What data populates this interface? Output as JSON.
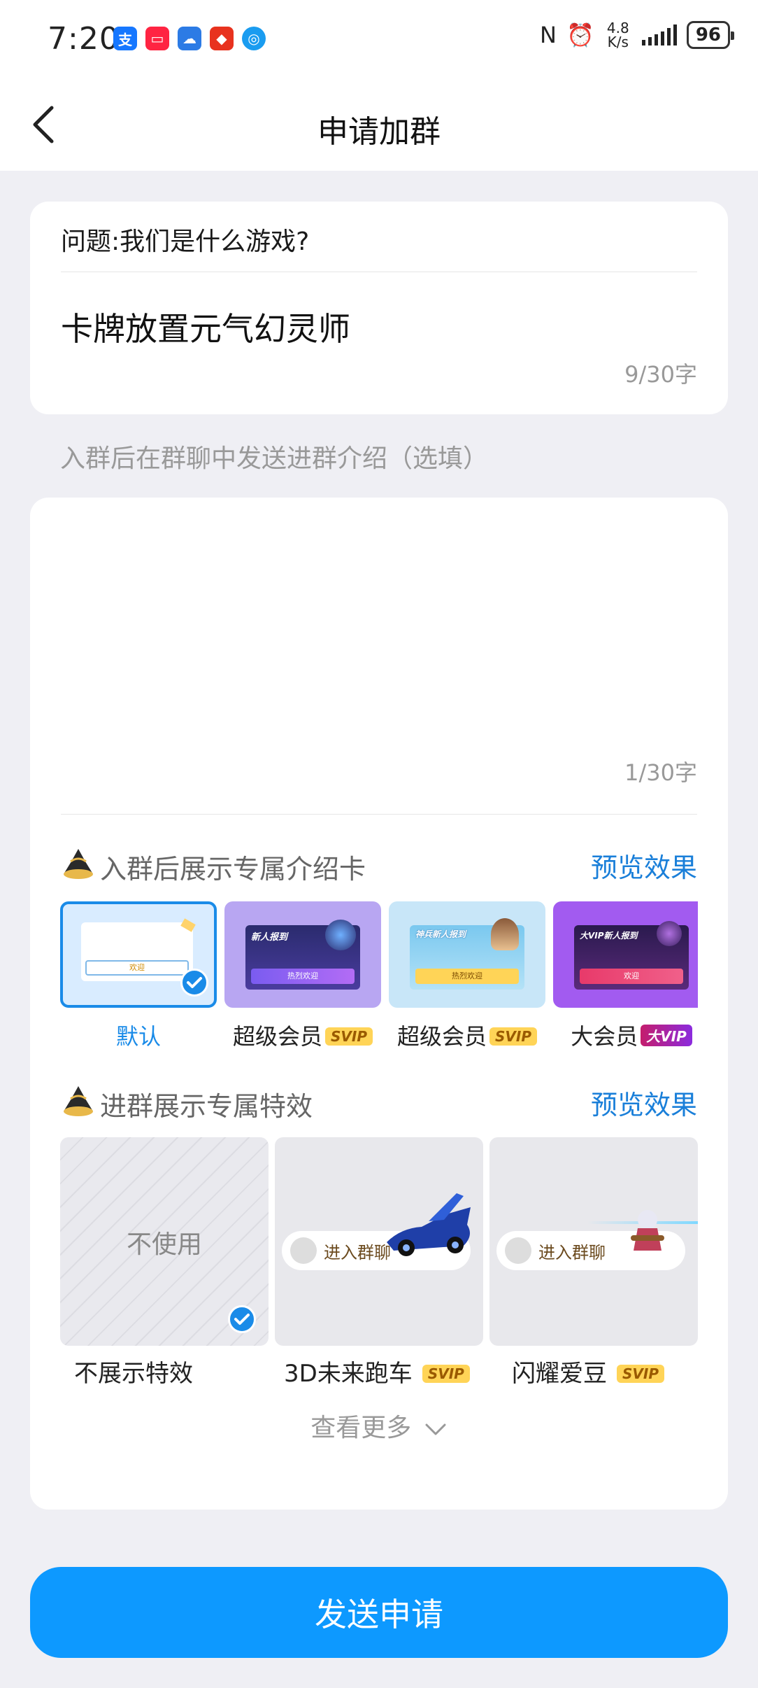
{
  "status_bar": {
    "time": "7:20",
    "net_speed": "4.8 K/s",
    "battery": "96",
    "app_icons": [
      "alipay-icon",
      "red-note-icon",
      "weather-icon",
      "shop-icon",
      "browser-icon"
    ]
  },
  "nav": {
    "title": "申请加群"
  },
  "question": {
    "text": "问题:我们是什么游戏?",
    "answer": "卡牌放置元气幻灵师",
    "count": "9/30字"
  },
  "intro": {
    "label": "入群后在群聊中发送进群介绍（选填）",
    "value": "",
    "count": "1/30字"
  },
  "intro_cards": {
    "title": "入群后展示专属介绍卡",
    "preview": "预览效果",
    "items": [
      {
        "label": "默认",
        "badge": "",
        "selected": true,
        "thumb_text": "欢迎"
      },
      {
        "label": "超级会员",
        "badge": "SVIP",
        "selected": false,
        "thumb_title": "新人报到",
        "thumb_text": "热烈欢迎"
      },
      {
        "label": "超级会员",
        "badge": "SVIP",
        "selected": false,
        "thumb_title": "神兵新人报到",
        "thumb_text": "热烈欢迎"
      },
      {
        "label": "大会员",
        "badge": "大VIP",
        "selected": false,
        "thumb_title": "大VIP新人报到",
        "thumb_text": "欢迎"
      }
    ]
  },
  "effects": {
    "title": "进群展示专属特效",
    "preview": "预览效果",
    "none_text": "不使用",
    "items": [
      {
        "label": "不展示特效",
        "badge": "",
        "selected": true
      },
      {
        "label": "3D未来跑车",
        "badge": "SVIP",
        "selected": false,
        "pill_text": "进入群聊"
      },
      {
        "label": "闪耀爱豆",
        "badge": "SVIP",
        "selected": false,
        "pill_text": "进入群聊"
      }
    ],
    "see_more": "查看更多"
  },
  "submit": {
    "label": "发送申请"
  },
  "colors": {
    "accent": "#0d99ff",
    "link": "#1a7fd9",
    "svip_badge": "#ffd457"
  }
}
